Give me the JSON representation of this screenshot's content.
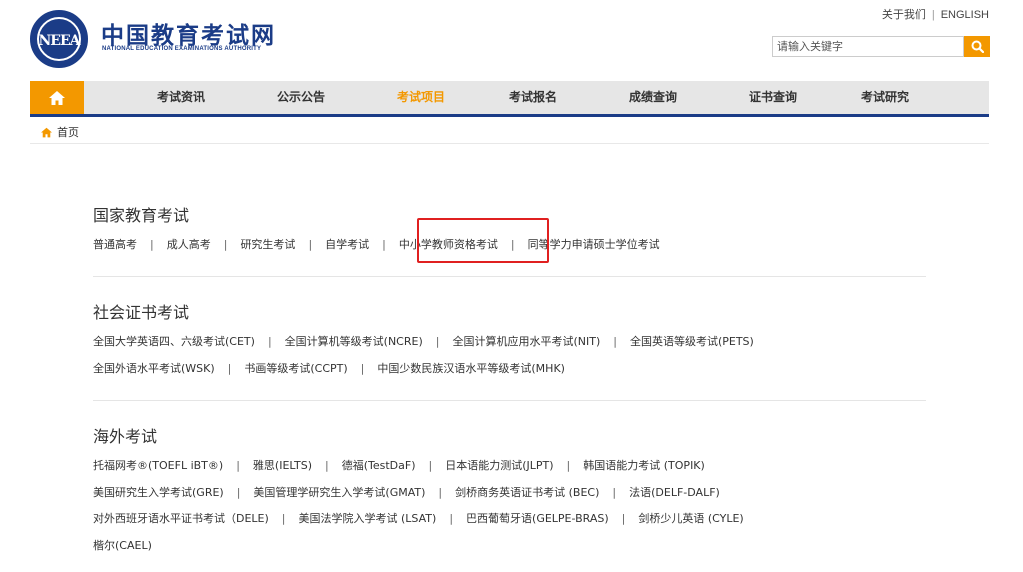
{
  "header": {
    "logo_emblem_text": "NEEA",
    "logo_cn": "中国教育考试网",
    "logo_en": "NATIONAL EDUCATION EXAMINATIONS AUTHORITY",
    "top_links": [
      "关于我们",
      "ENGLISH"
    ],
    "search_placeholder": "请输入关键字"
  },
  "nav": {
    "items": [
      "考试资讯",
      "公示公告",
      "考试项目",
      "考试报名",
      "成绩查询",
      "证书查询",
      "考试研究"
    ],
    "active": "考试项目",
    "accent_color": "#f39800",
    "brand_color": "#1b3c87"
  },
  "breadcrumb": {
    "label": "首页"
  },
  "sections": [
    {
      "title": "国家教育考试",
      "rows": [
        [
          "普通高考",
          "成人高考",
          "研究生考试",
          "自学考试",
          "中小学教师资格考试",
          "同等学力申请硕士学位考试"
        ]
      ]
    },
    {
      "title": "社会证书考试",
      "rows": [
        [
          "全国大学英语四、六级考试(CET)",
          "全国计算机等级考试(NCRE)",
          "全国计算机应用水平考试(NIT)",
          "全国英语等级考试(PETS)"
        ],
        [
          "全国外语水平考试(WSK)",
          "书画等级考试(CCPT)",
          "中国少数民族汉语水平等级考试(MHK)"
        ]
      ]
    },
    {
      "title": "海外考试",
      "rows": [
        [
          "托福网考®(TOEFL iBT®)",
          "雅思(IELTS)",
          "德福(TestDaF)",
          "日本语能力测试(JLPT)",
          "韩国语能力考试 (TOPIK)"
        ],
        [
          "美国研究生入学考试(GRE)",
          "美国管理学研究生入学考试(GMAT)",
          "剑桥商务英语证书考试 (BEC)",
          "法语(DELF-DALF)"
        ],
        [
          "对外西班牙语水平证书考试（DELE)",
          "美国法学院入学考试 (LSAT)",
          "巴西葡萄牙语(GELPE-BRAS)",
          "剑桥少儿英语 (CYLE)"
        ],
        [
          "楷尔(CAEL)"
        ]
      ]
    }
  ],
  "highlighted_item": "中小学教师资格考试"
}
